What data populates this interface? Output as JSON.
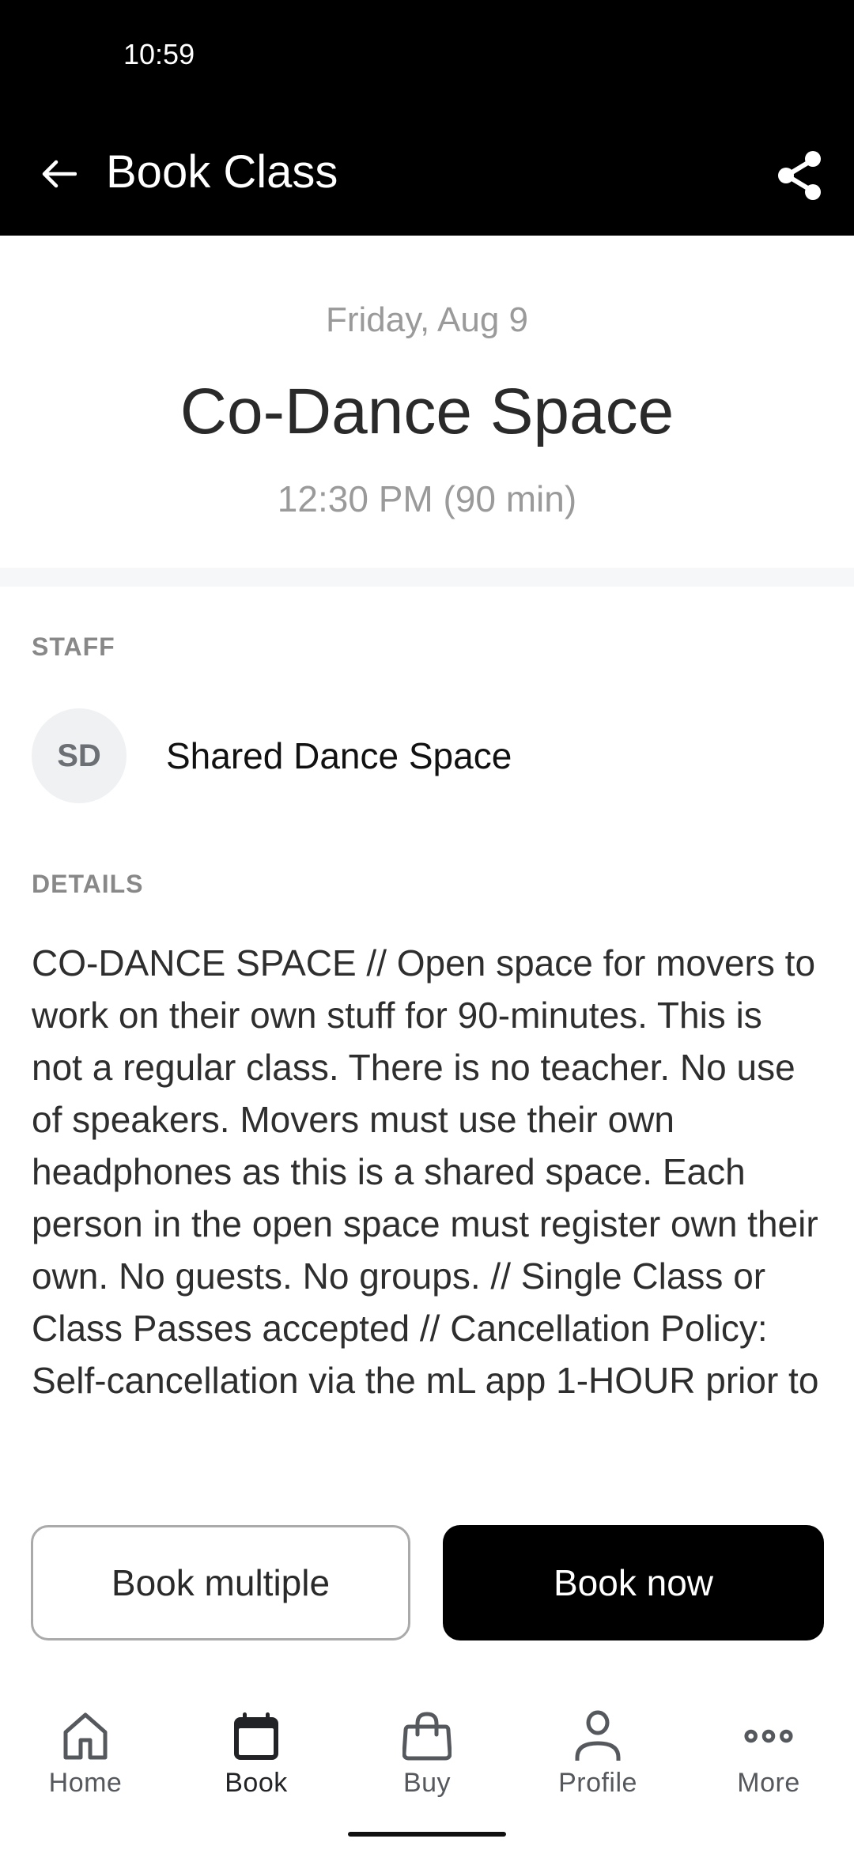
{
  "status_bar": {
    "time": "10:59"
  },
  "app_bar": {
    "title": "Book Class",
    "back_icon": "arrow-left-icon",
    "share_icon": "share-icon"
  },
  "class": {
    "date": "Friday, Aug 9",
    "title": "Co-Dance Space",
    "time": "12:30 PM (90 min)"
  },
  "staff": {
    "section_label": "STAFF",
    "initials": "SD",
    "name": "Shared Dance Space"
  },
  "details": {
    "section_label": "DETAILS",
    "text": "CO-DANCE SPACE // Open space for movers to work on their own stuff for 90-minutes. This is not a regular class. There is no teacher. No use of speakers. Movers must use their own headphones as this is a shared space. Each person in the open space must register own their own. No guests. No groups. // Single Class or Class Passes accepted // Cancellation Policy: Self-cancellation via the mL app 1-HOUR prior to"
  },
  "actions": {
    "book_multiple": "Book multiple",
    "book_now": "Book now"
  },
  "bottom_nav": {
    "items": [
      {
        "label": "Home",
        "icon": "home-icon",
        "active": false
      },
      {
        "label": "Book",
        "icon": "calendar-icon",
        "active": true
      },
      {
        "label": "Buy",
        "icon": "shopping-bag-icon",
        "active": false
      },
      {
        "label": "Profile",
        "icon": "person-icon",
        "active": false
      },
      {
        "label": "More",
        "icon": "more-dots-icon",
        "active": false
      }
    ]
  },
  "colors": {
    "app_bar_bg": "#000000",
    "primary_button_bg": "#000000",
    "muted_text": "#9a9a9a",
    "section_label": "#888888",
    "avatar_bg": "#eff1f3",
    "nav_icon": "#55585c"
  }
}
